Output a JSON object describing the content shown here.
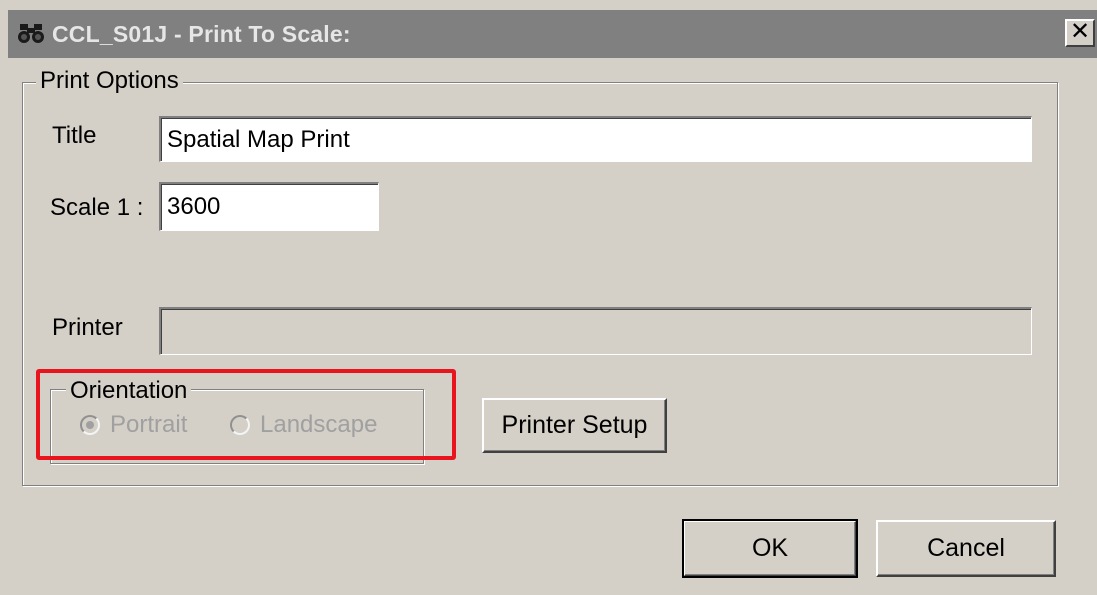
{
  "window": {
    "title": "CCL_S01J - Print To Scale:",
    "close_label": "✕"
  },
  "print_options": {
    "legend": "Print Options",
    "title_label": "Title",
    "title_value": "Spatial Map Print",
    "scale_label": "Scale 1 :",
    "scale_value": "3600",
    "printer_label": "Printer",
    "printer_value": ""
  },
  "orientation": {
    "legend": "Orientation",
    "portrait_label": "Portrait",
    "landscape_label": "Landscape",
    "selected": "Portrait"
  },
  "buttons": {
    "printer_setup": "Printer Setup",
    "ok": "OK",
    "cancel": "Cancel"
  },
  "colors": {
    "highlight": "#e8141e",
    "titlebar": "#808080",
    "face": "#d4d0c8"
  }
}
